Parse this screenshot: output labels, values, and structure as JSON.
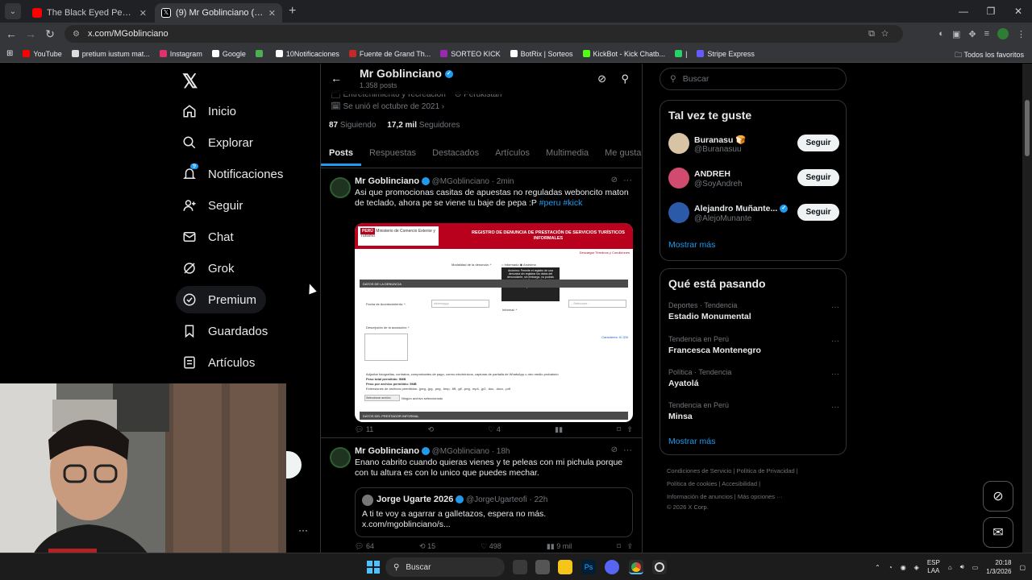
{
  "browser": {
    "tabs": [
      {
        "title": "The Black Eyed Peas - Where Is",
        "active": false,
        "fav_color": "#ff0000"
      },
      {
        "title": "(9) Mr Goblinciano (@MGoblin",
        "active": true,
        "fav_color": "#ffffff"
      }
    ],
    "url": "x.com/MGoblinciano",
    "bookmarks": [
      {
        "label": "YouTube",
        "color": "#ff0000"
      },
      {
        "label": "pretium iustum mat...",
        "color": "#dddddd"
      },
      {
        "label": "Instagram",
        "color": "#e1306c"
      },
      {
        "label": "Google",
        "color": "#ffffff"
      },
      {
        "label": "",
        "color": "#4caf50"
      },
      {
        "label": "10Notificaciones",
        "color": "#ffffff"
      },
      {
        "label": "Fuente de Grand Th...",
        "color": "#c62828"
      },
      {
        "label": "SORTEO KICK",
        "color": "#9c27b0"
      },
      {
        "label": "BotRix | Sorteos",
        "color": "#ffffff"
      },
      {
        "label": "KickBot - Kick Chatb...",
        "color": "#53fc18"
      },
      {
        "label": "|",
        "color": "#25d366"
      },
      {
        "label": "Stripe Express",
        "color": "#635bff"
      }
    ],
    "bookmarks_folder": "Todos los favoritos"
  },
  "nav": {
    "items": [
      {
        "label": "Inicio",
        "icon": "home-icon"
      },
      {
        "label": "Explorar",
        "icon": "search-icon"
      },
      {
        "label": "Notificaciones",
        "icon": "bell-icon",
        "badge": "9"
      },
      {
        "label": "Seguir",
        "icon": "add-person-icon"
      },
      {
        "label": "Chat",
        "icon": "mail-icon"
      },
      {
        "label": "Grok",
        "icon": "grok-icon"
      },
      {
        "label": "Premium",
        "icon": "premium-icon"
      },
      {
        "label": "Guardados",
        "icon": "bookmark-icon"
      },
      {
        "label": "Artículos",
        "icon": "article-icon"
      }
    ]
  },
  "profile": {
    "name": "Mr Goblinciano",
    "post_count": "1.358 posts",
    "category": "Entretenimiento y recreación",
    "location": "Perukistan",
    "joined": "Se unió el octubre de 2021",
    "following_count": "87",
    "following_label": "Siguiendo",
    "followers_count": "17,2 mil",
    "followers_label": "Seguidores",
    "tabs": [
      "Posts",
      "Respuestas",
      "Destacados",
      "Artículos",
      "Multimedia",
      "Me gusta"
    ]
  },
  "tweets": [
    {
      "name": "Mr Goblinciano",
      "handle": "@MGoblinciano",
      "time": "· 2min",
      "text": "Asi que promocionas casitas de apuestas no reguladas weboncito maton de teclado, ahora pe se viene tu baje de pepa :P",
      "hashtags": "#peru #kick",
      "image": {
        "header": "REGISTRO DE DENUNCIA DE PRESTACIÓN DE SERVICIOS TURÍSTICOS INFORMALES",
        "logo_country": "PERÚ",
        "logo_ministry": "Ministerio de Comercio Exterior y Turismo",
        "link": "Descargar Términos y Condiciones",
        "modalidad": "Modalidad de la denuncia: *",
        "opt_informado": "Informado",
        "opt_anonimo": "Anónimo",
        "tooltip": "Anónimo: Permite el registro de una denuncia sin registrar los datos del denunciante, sin embargo, no podrás conocer en detalle cuáles fueron las acciones ejecutadas y/o sanciones impuestas.",
        "section1": "DATOS DE LA DENUNCIA",
        "fecha_label": "Fecha de Acontecimiento: *",
        "fecha_placeholder": "dd/mm/yyyy",
        "informal_label": "Informal: *",
        "select_placeholder": "-- Seleccione --",
        "desc_label": "Descripción de la acusación: *",
        "char_label": "Caracteres: 0/ 200",
        "attach_text": "Adjuntar fotografías, contratos, comprobantes de pago, correo electrónicos, capturas de pantalla de WhatsApp u otro medio probatorio",
        "peso_total": "Peso total permitido: 5MB",
        "peso_archivo": "Peso por archivo permitido: 5MB",
        "extensiones": "Extensiones de archivos permitidos: .jpeg, .jpg, .png, .bmp, .tiff, .gif, .png, .mp4, .jp2, .doc, .docx, .pdf",
        "select_file_btn": "Seleccionar archivo",
        "no_file": "Ningún archivo seleccionado",
        "section2": "DATOS DEL PRESTADOR INFORMAL"
      },
      "replies": "11",
      "retweets": "",
      "likes": "4",
      "views": ""
    },
    {
      "name": "Mr Goblinciano",
      "handle": "@MGoblinciano",
      "time": "· 18h",
      "text": "Enano cabrito cuando quieras vienes y te peleas con mi pichula porque con tu altura es con lo unico que puedes mechar.",
      "quote": {
        "name": "Jorge Ugarte 2026",
        "handle": "@JorgeUgarteofi",
        "time": "· 22h",
        "text1": "A ti te voy a agarrar a galletazos, espera no más.",
        "text2": "x.com/mgoblinciano/s..."
      },
      "replies": "64",
      "retweets": "15",
      "likes": "498",
      "views": "9 mil"
    }
  ],
  "right": {
    "search_placeholder": "Buscar",
    "suggestions_title": "Tal vez te guste",
    "suggestions": [
      {
        "name": "Buranasu 🍞",
        "handle": "@Buranasuu",
        "verified": false,
        "color": "#d8c3a5"
      },
      {
        "name": "ANDREH",
        "handle": "@SoyAndreh",
        "verified": false,
        "color": "#d14b6e"
      },
      {
        "name": "Alejandro Muñante...",
        "handle": "@AlejoMunante",
        "verified": true,
        "color": "#2b5aa8"
      }
    ],
    "follow_label": "Seguir",
    "show_more": "Mostrar más",
    "trends_title": "Qué está pasando",
    "trends": [
      {
        "category": "Deportes · Tendencia",
        "name": "Estadio Monumental"
      },
      {
        "category": "Tendencia en Perú",
        "name": "Francesca Montenegro"
      },
      {
        "category": "Política · Tendencia",
        "name": "Ayatolá"
      },
      {
        "category": "Tendencia en Perú",
        "name": "Minsa"
      }
    ],
    "footer_line1": "Condiciones de Servicio  |  Política de Privacidad  |",
    "footer_line2": "Política de cookies  |  Accesibilidad  |",
    "footer_line3": "Información de anuncios  |  Más opciones ···",
    "footer_line4": "© 2026 X Corp."
  },
  "taskbar": {
    "search_label": "Buscar",
    "lang1": "ESP",
    "lang2": "LAA",
    "time": "20:18",
    "date": "1/3/2026"
  }
}
